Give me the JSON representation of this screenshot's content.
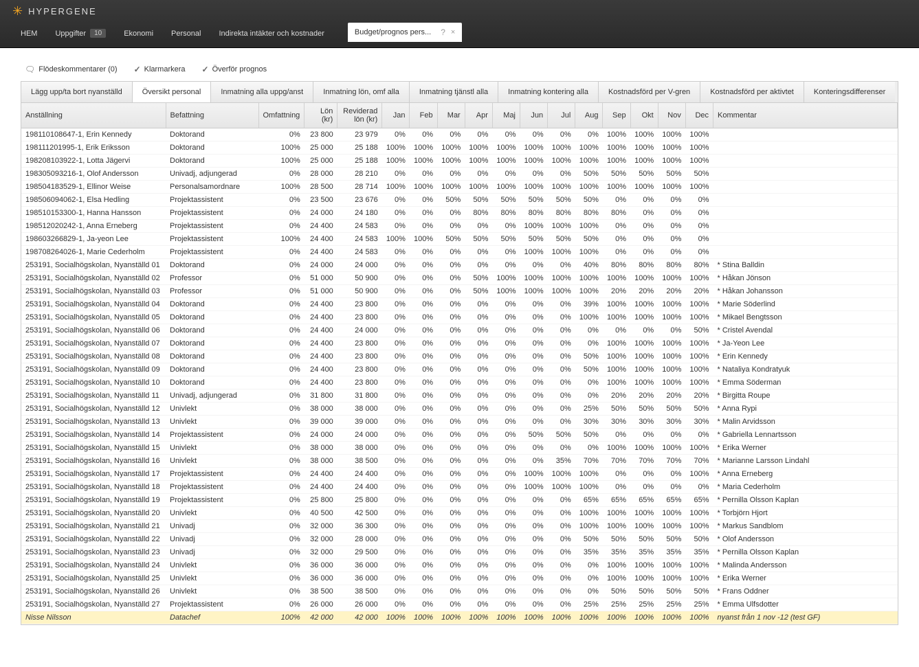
{
  "brand": "HYPERGENE",
  "nav": {
    "items": [
      {
        "label": "HEM"
      },
      {
        "label": "Uppgifter",
        "badge": "10"
      },
      {
        "label": "Ekonomi"
      },
      {
        "label": "Personal"
      },
      {
        "label": "Indirekta intäkter och kostnader"
      }
    ],
    "doc_tab": "Budget/prognos pers..."
  },
  "toolbar": {
    "flodes": "Flödeskommentarer (0)",
    "klar": "Klarmarkera",
    "overfor": "Överför prognos"
  },
  "subtabs": [
    "Lägg upp/ta bort nyanställd",
    "Översikt personal",
    "Inmatning alla uppg/anst",
    "Inmatning lön, omf alla",
    "Inmatning tjänstl alla",
    "Inmatning kontering alla",
    "Kostnadsförd per V-gren",
    "Kostnadsförd per aktivtet",
    "Konteringsdifferenser"
  ],
  "active_subtab": 1,
  "headers": {
    "anst": "Anställning",
    "bef": "Befattning",
    "omf": "Omfattning",
    "lon": "Lön (kr)",
    "rev": "Reviderad lön (kr)",
    "months": [
      "Jan",
      "Feb",
      "Mar",
      "Apr",
      "Maj",
      "Jun",
      "Jul",
      "Aug",
      "Sep",
      "Okt",
      "Nov",
      "Dec"
    ],
    "kom": "Kommentar"
  },
  "rows": [
    {
      "a": "198110108647-1, Erin Kennedy",
      "b": "Doktorand",
      "o": "0%",
      "l": "23 800",
      "r": "23 979",
      "m": [
        "0%",
        "0%",
        "0%",
        "0%",
        "0%",
        "0%",
        "0%",
        "0%",
        "100%",
        "100%",
        "100%",
        "100%"
      ],
      "k": ""
    },
    {
      "a": "198111201995-1, Erik Eriksson",
      "b": "Doktorand",
      "o": "100%",
      "l": "25 000",
      "r": "25 188",
      "m": [
        "100%",
        "100%",
        "100%",
        "100%",
        "100%",
        "100%",
        "100%",
        "100%",
        "100%",
        "100%",
        "100%",
        "100%"
      ],
      "k": ""
    },
    {
      "a": "198208103922-1, Lotta Jägervi",
      "b": "Doktorand",
      "o": "100%",
      "l": "25 000",
      "r": "25 188",
      "m": [
        "100%",
        "100%",
        "100%",
        "100%",
        "100%",
        "100%",
        "100%",
        "100%",
        "100%",
        "100%",
        "100%",
        "100%"
      ],
      "k": ""
    },
    {
      "a": "198305093216-1, Olof Andersson",
      "b": "Univadj, adjungerad",
      "o": "0%",
      "l": "28 000",
      "r": "28 210",
      "m": [
        "0%",
        "0%",
        "0%",
        "0%",
        "0%",
        "0%",
        "0%",
        "50%",
        "50%",
        "50%",
        "50%",
        "50%"
      ],
      "k": ""
    },
    {
      "a": "198504183529-1, Ellinor Weise",
      "b": "Personalsamordnare",
      "o": "100%",
      "l": "28 500",
      "r": "28 714",
      "m": [
        "100%",
        "100%",
        "100%",
        "100%",
        "100%",
        "100%",
        "100%",
        "100%",
        "100%",
        "100%",
        "100%",
        "100%"
      ],
      "k": ""
    },
    {
      "a": "198506094062-1, Elsa Hedling",
      "b": "Projektassistent",
      "o": "0%",
      "l": "23 500",
      "r": "23 676",
      "m": [
        "0%",
        "0%",
        "50%",
        "50%",
        "50%",
        "50%",
        "50%",
        "50%",
        "0%",
        "0%",
        "0%",
        "0%"
      ],
      "k": ""
    },
    {
      "a": "198510153300-1, Hanna Hansson",
      "b": "Projektassistent",
      "o": "0%",
      "l": "24 000",
      "r": "24 180",
      "m": [
        "0%",
        "0%",
        "0%",
        "80%",
        "80%",
        "80%",
        "80%",
        "80%",
        "80%",
        "0%",
        "0%",
        "0%"
      ],
      "k": ""
    },
    {
      "a": "198512020242-1, Anna Erneberg",
      "b": "Projektassistent",
      "o": "0%",
      "l": "24 400",
      "r": "24 583",
      "m": [
        "0%",
        "0%",
        "0%",
        "0%",
        "0%",
        "100%",
        "100%",
        "100%",
        "0%",
        "0%",
        "0%",
        "0%"
      ],
      "k": ""
    },
    {
      "a": "198603266829-1, Ja-yeon Lee",
      "b": "Projektassistent",
      "o": "100%",
      "l": "24 400",
      "r": "24 583",
      "m": [
        "100%",
        "100%",
        "50%",
        "50%",
        "50%",
        "50%",
        "50%",
        "50%",
        "0%",
        "0%",
        "0%",
        "0%"
      ],
      "k": ""
    },
    {
      "a": "198708264026-1, Marie Cederholm",
      "b": "Projektassistent",
      "o": "0%",
      "l": "24 400",
      "r": "24 583",
      "m": [
        "0%",
        "0%",
        "0%",
        "0%",
        "0%",
        "100%",
        "100%",
        "100%",
        "0%",
        "0%",
        "0%",
        "0%"
      ],
      "k": ""
    },
    {
      "a": "253191, Socialhögskolan, Nyanställd 01",
      "b": "Doktorand",
      "o": "0%",
      "l": "24 000",
      "r": "24 000",
      "m": [
        "0%",
        "0%",
        "0%",
        "0%",
        "0%",
        "0%",
        "0%",
        "40%",
        "80%",
        "80%",
        "80%",
        "80%"
      ],
      "k": "* Stina Balldin"
    },
    {
      "a": "253191, Socialhögskolan, Nyanställd 02",
      "b": "Professor",
      "o": "0%",
      "l": "51 000",
      "r": "50 900",
      "m": [
        "0%",
        "0%",
        "0%",
        "50%",
        "100%",
        "100%",
        "100%",
        "100%",
        "100%",
        "100%",
        "100%",
        "100%"
      ],
      "k": "* Håkan Jönson"
    },
    {
      "a": "253191, Socialhögskolan, Nyanställd 03",
      "b": "Professor",
      "o": "0%",
      "l": "51 000",
      "r": "50 900",
      "m": [
        "0%",
        "0%",
        "0%",
        "50%",
        "100%",
        "100%",
        "100%",
        "100%",
        "20%",
        "20%",
        "20%",
        "20%"
      ],
      "k": "* Håkan Johansson"
    },
    {
      "a": "253191, Socialhögskolan, Nyanställd 04",
      "b": "Doktorand",
      "o": "0%",
      "l": "24 400",
      "r": "23 800",
      "m": [
        "0%",
        "0%",
        "0%",
        "0%",
        "0%",
        "0%",
        "0%",
        "39%",
        "100%",
        "100%",
        "100%",
        "100%"
      ],
      "k": "* Marie Söderlind"
    },
    {
      "a": "253191, Socialhögskolan, Nyanställd 05",
      "b": "Doktorand",
      "o": "0%",
      "l": "24 400",
      "r": "23 800",
      "m": [
        "0%",
        "0%",
        "0%",
        "0%",
        "0%",
        "0%",
        "0%",
        "100%",
        "100%",
        "100%",
        "100%",
        "100%"
      ],
      "k": "* Mikael Bengtsson"
    },
    {
      "a": "253191, Socialhögskolan, Nyanställd 06",
      "b": "Doktorand",
      "o": "0%",
      "l": "24 400",
      "r": "24 000",
      "m": [
        "0%",
        "0%",
        "0%",
        "0%",
        "0%",
        "0%",
        "0%",
        "0%",
        "0%",
        "0%",
        "0%",
        "50%"
      ],
      "k": "* Cristel Avendal"
    },
    {
      "a": "253191, Socialhögskolan, Nyanställd 07",
      "b": "Doktorand",
      "o": "0%",
      "l": "24 400",
      "r": "23 800",
      "m": [
        "0%",
        "0%",
        "0%",
        "0%",
        "0%",
        "0%",
        "0%",
        "0%",
        "100%",
        "100%",
        "100%",
        "100%"
      ],
      "k": "* Ja-Yeon Lee"
    },
    {
      "a": "253191, Socialhögskolan, Nyanställd 08",
      "b": "Doktorand",
      "o": "0%",
      "l": "24 400",
      "r": "23 800",
      "m": [
        "0%",
        "0%",
        "0%",
        "0%",
        "0%",
        "0%",
        "0%",
        "50%",
        "100%",
        "100%",
        "100%",
        "100%"
      ],
      "k": "* Erin Kennedy"
    },
    {
      "a": "253191, Socialhögskolan, Nyanställd 09",
      "b": "Doktorand",
      "o": "0%",
      "l": "24 400",
      "r": "23 800",
      "m": [
        "0%",
        "0%",
        "0%",
        "0%",
        "0%",
        "0%",
        "0%",
        "50%",
        "100%",
        "100%",
        "100%",
        "100%"
      ],
      "k": "* Nataliya Kondratyuk"
    },
    {
      "a": "253191, Socialhögskolan, Nyanställd 10",
      "b": "Doktorand",
      "o": "0%",
      "l": "24 400",
      "r": "23 800",
      "m": [
        "0%",
        "0%",
        "0%",
        "0%",
        "0%",
        "0%",
        "0%",
        "0%",
        "100%",
        "100%",
        "100%",
        "100%"
      ],
      "k": "* Emma Söderman"
    },
    {
      "a": "253191, Socialhögskolan, Nyanställd 11",
      "b": "Univadj, adjungerad",
      "o": "0%",
      "l": "31 800",
      "r": "31 800",
      "m": [
        "0%",
        "0%",
        "0%",
        "0%",
        "0%",
        "0%",
        "0%",
        "0%",
        "20%",
        "20%",
        "20%",
        "20%"
      ],
      "k": "* Birgitta Roupe"
    },
    {
      "a": "253191, Socialhögskolan, Nyanställd 12",
      "b": "Univlekt",
      "o": "0%",
      "l": "38 000",
      "r": "38 000",
      "m": [
        "0%",
        "0%",
        "0%",
        "0%",
        "0%",
        "0%",
        "0%",
        "25%",
        "50%",
        "50%",
        "50%",
        "50%"
      ],
      "k": "* Anna Rypi"
    },
    {
      "a": "253191, Socialhögskolan, Nyanställd 13",
      "b": "Univlekt",
      "o": "0%",
      "l": "39 000",
      "r": "39 000",
      "m": [
        "0%",
        "0%",
        "0%",
        "0%",
        "0%",
        "0%",
        "0%",
        "30%",
        "30%",
        "30%",
        "30%",
        "30%"
      ],
      "k": "* Malin Arvidsson"
    },
    {
      "a": "253191, Socialhögskolan, Nyanställd 14",
      "b": "Projektassistent",
      "o": "0%",
      "l": "24 000",
      "r": "24 000",
      "m": [
        "0%",
        "0%",
        "0%",
        "0%",
        "0%",
        "50%",
        "50%",
        "50%",
        "0%",
        "0%",
        "0%",
        "0%"
      ],
      "k": "* Gabriella Lennartsson"
    },
    {
      "a": "253191, Socialhögskolan, Nyanställd 15",
      "b": "Univlekt",
      "o": "0%",
      "l": "38 000",
      "r": "38 000",
      "m": [
        "0%",
        "0%",
        "0%",
        "0%",
        "0%",
        "0%",
        "0%",
        "0%",
        "100%",
        "100%",
        "100%",
        "100%"
      ],
      "k": "* Erika Werner"
    },
    {
      "a": "253191, Socialhögskolan, Nyanställd 16",
      "b": "Univlekt",
      "o": "0%",
      "l": "38 000",
      "r": "38 500",
      "m": [
        "0%",
        "0%",
        "0%",
        "0%",
        "0%",
        "0%",
        "35%",
        "70%",
        "70%",
        "70%",
        "70%",
        "70%"
      ],
      "k": "* Marianne Larsson Lindahl"
    },
    {
      "a": "253191, Socialhögskolan, Nyanställd 17",
      "b": "Projektassistent",
      "o": "0%",
      "l": "24 400",
      "r": "24 400",
      "m": [
        "0%",
        "0%",
        "0%",
        "0%",
        "0%",
        "100%",
        "100%",
        "100%",
        "0%",
        "0%",
        "0%",
        "100%"
      ],
      "k": "* Anna Erneberg"
    },
    {
      "a": "253191, Socialhögskolan, Nyanställd 18",
      "b": "Projektassistent",
      "o": "0%",
      "l": "24 400",
      "r": "24 400",
      "m": [
        "0%",
        "0%",
        "0%",
        "0%",
        "0%",
        "100%",
        "100%",
        "100%",
        "0%",
        "0%",
        "0%",
        "0%"
      ],
      "k": "* Maria Cederholm"
    },
    {
      "a": "253191, Socialhögskolan, Nyanställd 19",
      "b": "Projektassistent",
      "o": "0%",
      "l": "25 800",
      "r": "25 800",
      "m": [
        "0%",
        "0%",
        "0%",
        "0%",
        "0%",
        "0%",
        "0%",
        "65%",
        "65%",
        "65%",
        "65%",
        "65%"
      ],
      "k": "* Pernilla Olsson Kaplan"
    },
    {
      "a": "253191, Socialhögskolan, Nyanställd 20",
      "b": "Univlekt",
      "o": "0%",
      "l": "40 500",
      "r": "42 500",
      "m": [
        "0%",
        "0%",
        "0%",
        "0%",
        "0%",
        "0%",
        "0%",
        "100%",
        "100%",
        "100%",
        "100%",
        "100%"
      ],
      "k": "* Torbjörn Hjort"
    },
    {
      "a": "253191, Socialhögskolan, Nyanställd 21",
      "b": "Univadj",
      "o": "0%",
      "l": "32 000",
      "r": "36 300",
      "m": [
        "0%",
        "0%",
        "0%",
        "0%",
        "0%",
        "0%",
        "0%",
        "100%",
        "100%",
        "100%",
        "100%",
        "100%"
      ],
      "k": "* Markus Sandblom"
    },
    {
      "a": "253191, Socialhögskolan, Nyanställd 22",
      "b": "Univadj",
      "o": "0%",
      "l": "32 000",
      "r": "28 000",
      "m": [
        "0%",
        "0%",
        "0%",
        "0%",
        "0%",
        "0%",
        "0%",
        "50%",
        "50%",
        "50%",
        "50%",
        "50%"
      ],
      "k": "* Olof Andersson"
    },
    {
      "a": "253191, Socialhögskolan, Nyanställd 23",
      "b": "Univadj",
      "o": "0%",
      "l": "32 000",
      "r": "29 500",
      "m": [
        "0%",
        "0%",
        "0%",
        "0%",
        "0%",
        "0%",
        "0%",
        "35%",
        "35%",
        "35%",
        "35%",
        "35%"
      ],
      "k": "* Pernilla Olsson Kaplan"
    },
    {
      "a": "253191, Socialhögskolan, Nyanställd 24",
      "b": "Univlekt",
      "o": "0%",
      "l": "36 000",
      "r": "36 000",
      "m": [
        "0%",
        "0%",
        "0%",
        "0%",
        "0%",
        "0%",
        "0%",
        "0%",
        "100%",
        "100%",
        "100%",
        "100%"
      ],
      "k": "* Malinda Andersson"
    },
    {
      "a": "253191, Socialhögskolan, Nyanställd 25",
      "b": "Univlekt",
      "o": "0%",
      "l": "36 000",
      "r": "36 000",
      "m": [
        "0%",
        "0%",
        "0%",
        "0%",
        "0%",
        "0%",
        "0%",
        "0%",
        "100%",
        "100%",
        "100%",
        "100%"
      ],
      "k": "* Erika Werner"
    },
    {
      "a": "253191, Socialhögskolan, Nyanställd 26",
      "b": "Univlekt",
      "o": "0%",
      "l": "38 500",
      "r": "38 500",
      "m": [
        "0%",
        "0%",
        "0%",
        "0%",
        "0%",
        "0%",
        "0%",
        "0%",
        "50%",
        "50%",
        "50%",
        "50%"
      ],
      "k": "* Frans Oddner"
    },
    {
      "a": "253191, Socialhögskolan, Nyanställd 27",
      "b": "Projektassistent",
      "o": "0%",
      "l": "26 000",
      "r": "26 000",
      "m": [
        "0%",
        "0%",
        "0%",
        "0%",
        "0%",
        "0%",
        "0%",
        "25%",
        "25%",
        "25%",
        "25%",
        "25%"
      ],
      "k": "* Emma Ulfsdotter"
    },
    {
      "a": "Nisse Nilsson",
      "b": "Datachef",
      "o": "100%",
      "l": "42 000",
      "r": "42 000",
      "m": [
        "100%",
        "100%",
        "100%",
        "100%",
        "100%",
        "100%",
        "100%",
        "100%",
        "100%",
        "100%",
        "100%",
        "100%"
      ],
      "k": "nyanst från 1 nov -12 (test GF)",
      "hl": true
    }
  ]
}
